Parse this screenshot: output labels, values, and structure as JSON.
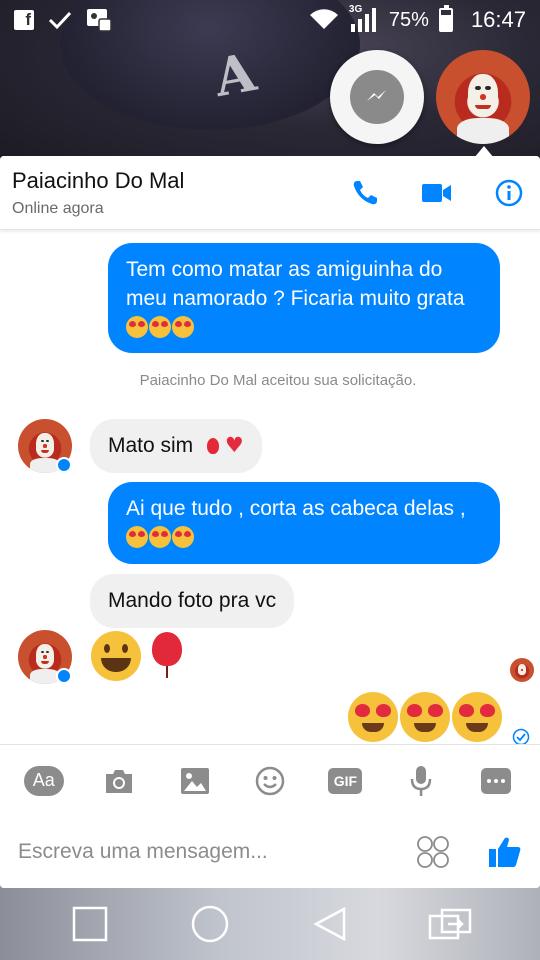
{
  "status_bar": {
    "battery_percent": "75%",
    "network": "3G",
    "time": "16:47",
    "battery_level": 0.75
  },
  "chat_header": {
    "contact_name": "Paiacinho Do Mal",
    "presence": "Online agora"
  },
  "messages": [
    {
      "direction": "out",
      "text": "Tem como matar as amiguinha do meu namorado ? Ficaria muito grata",
      "emoji": [
        "heart-eyes",
        "heart-eyes",
        "heart-eyes"
      ]
    },
    {
      "direction": "system",
      "text": "Paiacinho Do Mal aceitou sua solicitação."
    },
    {
      "direction": "in",
      "text": "Mato sim",
      "emoji": [
        "balloon",
        "red-heart"
      ]
    },
    {
      "direction": "out",
      "text": "Ai que tudo , corta as cabeca delas ,",
      "emoji": [
        "heart-eyes",
        "heart-eyes",
        "heart-eyes"
      ]
    },
    {
      "direction": "in",
      "text": "Mando foto pra vc"
    },
    {
      "direction": "in",
      "emoji_only": [
        "grinning-face",
        "balloon"
      ]
    },
    {
      "direction": "out",
      "emoji_only": [
        "heart-eyes",
        "heart-eyes",
        "heart-eyes"
      ],
      "status": "seen"
    }
  ],
  "composer": {
    "placeholder": "Escreva uma mensagem...",
    "aa_label": "Aa",
    "gif_label": "GIF",
    "tools": [
      "text-format-icon",
      "camera-icon",
      "gallery-icon",
      "emoji-icon",
      "gif-icon",
      "microphone-icon",
      "more-icon"
    ]
  },
  "colors": {
    "accent": "#0084ff",
    "incoming_bubble": "#f1f0f0",
    "muted_icon": "#8c8c8c"
  }
}
